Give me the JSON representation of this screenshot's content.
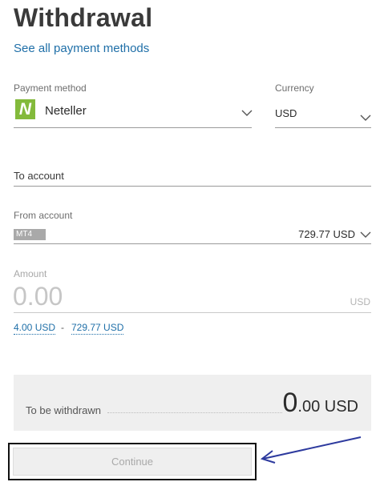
{
  "page": {
    "title": "Withdrawal",
    "see_all_link": "See all payment methods"
  },
  "payment_method": {
    "label": "Payment method",
    "value": "Neteller",
    "logo_letter": "N",
    "logo_color": "#83ba3b"
  },
  "currency": {
    "label": "Currency",
    "value": "USD"
  },
  "to_account": {
    "label": "To account"
  },
  "from_account": {
    "label": "From account",
    "badge": "MT4",
    "value": "729.77 USD"
  },
  "amount": {
    "label": "Amount",
    "value": "0.00",
    "currency": "USD",
    "min": "4.00 USD",
    "separator": "-",
    "max": "729.77 USD"
  },
  "summary": {
    "label": "To be withdrawn",
    "amount_int": "0",
    "amount_dec": ".00 USD"
  },
  "actions": {
    "continue_label": "Continue"
  },
  "colors": {
    "link": "#1f6fa8",
    "annotation": "#2d3a9e"
  }
}
